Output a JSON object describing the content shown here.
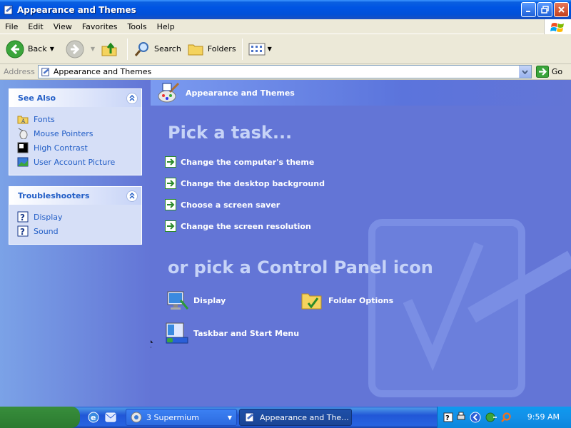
{
  "window": {
    "title": "Appearance and Themes"
  },
  "menu": [
    "File",
    "Edit",
    "View",
    "Favorites",
    "Tools",
    "Help"
  ],
  "toolbar": {
    "back": "Back",
    "search": "Search",
    "folders": "Folders"
  },
  "address": {
    "label": "Address",
    "value": "Appearance and Themes",
    "go": "Go"
  },
  "see_also": {
    "title": "See Also",
    "items": [
      "Fonts",
      "Mouse Pointers",
      "High Contrast",
      "User Account Picture"
    ]
  },
  "troubleshooters": {
    "title": "Troubleshooters",
    "items": [
      "Display",
      "Sound"
    ]
  },
  "main": {
    "header": "Appearance and Themes",
    "task_heading": "Pick a task...",
    "tasks": [
      "Change the computer's theme",
      "Change the desktop background",
      "Choose a screen saver",
      "Change the screen resolution"
    ],
    "cp_heading": "or pick a Control Panel icon",
    "icons": [
      "Display",
      "Folder Options",
      "Taskbar and Start Menu"
    ]
  },
  "taskbar": {
    "supermium": "3 Supermium",
    "window": "Appearance and The...",
    "clock": "9:59 AM"
  }
}
